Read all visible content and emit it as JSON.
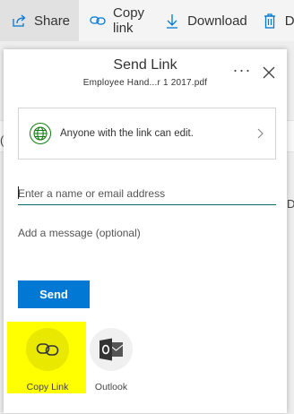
{
  "toolbar": {
    "share_label": "Share",
    "copy_link_label": "Copy link",
    "download_label": "Download",
    "delete_label": "D"
  },
  "background": {
    "left_letter": "(",
    "right_letter": "D"
  },
  "dialog": {
    "title": "Send Link",
    "subtitle": "Employee Hand...r 1 2017.pdf",
    "more_label": "···",
    "permission_text": "Anyone with the link can edit.",
    "email_placeholder": "Enter a name or email address",
    "message_placeholder": "Add a message (optional)",
    "send_label": "Send",
    "share_options": [
      {
        "label": "Copy Link",
        "icon": "link-icon"
      },
      {
        "label": "Outlook",
        "icon": "outlook-icon"
      }
    ]
  },
  "colors": {
    "accent": "#0078d4",
    "highlight": "#ffff00",
    "globe": "#107c10"
  }
}
